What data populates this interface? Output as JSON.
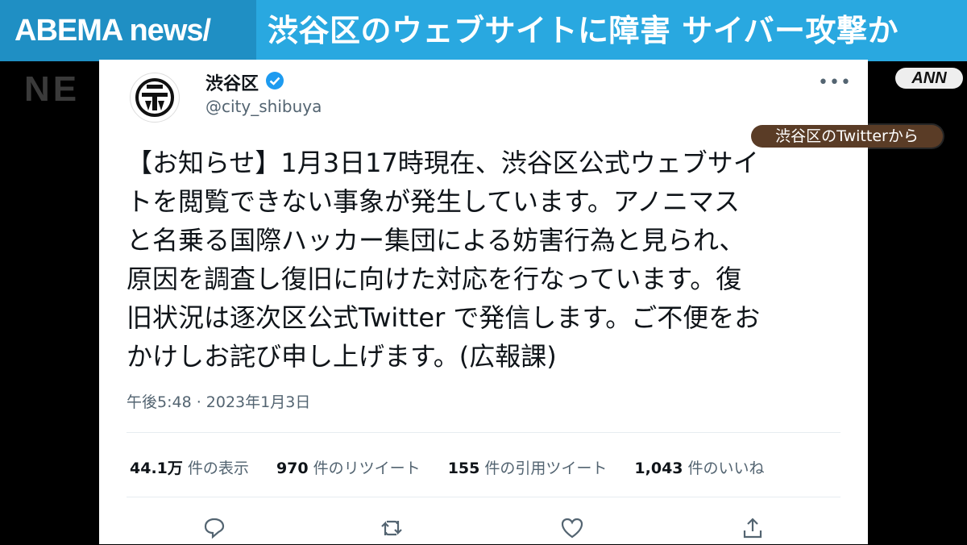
{
  "banner": {
    "brand": "ABEMA news/",
    "headline": "渋谷区のウェブサイトに障害 サイバー攻撃か"
  },
  "watermark": "NE",
  "ann_badge": "ANN",
  "source_label": "渋谷区のTwitterから",
  "tweet": {
    "name": "渋谷区",
    "handle": "@city_shibuya",
    "more": "•••",
    "lines": [
      "【お知らせ】1月3日17時現在、渋谷区公式ウェブサイ",
      "トを閲覧できない事象が発生しています。アノニマス",
      "と名乗る国際ハッカー集団による妨害行為と見られ、",
      "原因を調査し復旧に向けた対応を行なっています。復",
      "旧状況は逐次区公式Twitter で発信します。ご不便をお",
      "かけしお詫び申し上げます。(広報課)"
    ],
    "timestamp": "午後5:48 · 2023年1月3日",
    "stats": [
      {
        "count": "44.1万",
        "label": "件の表示"
      },
      {
        "count": "970",
        "label": "件のリツイート"
      },
      {
        "count": "155",
        "label": "件の引用ツイート"
      },
      {
        "count": "1,043",
        "label": "件のいいね"
      }
    ],
    "actions": [
      "reply-icon",
      "retweet-icon",
      "like-icon",
      "share-icon"
    ]
  },
  "colors": {
    "banner": "#29a8e0",
    "brand_bg": "#1f8fc4",
    "verified": "#1d9bf0",
    "muted": "#536471",
    "text": "#0f1419"
  }
}
